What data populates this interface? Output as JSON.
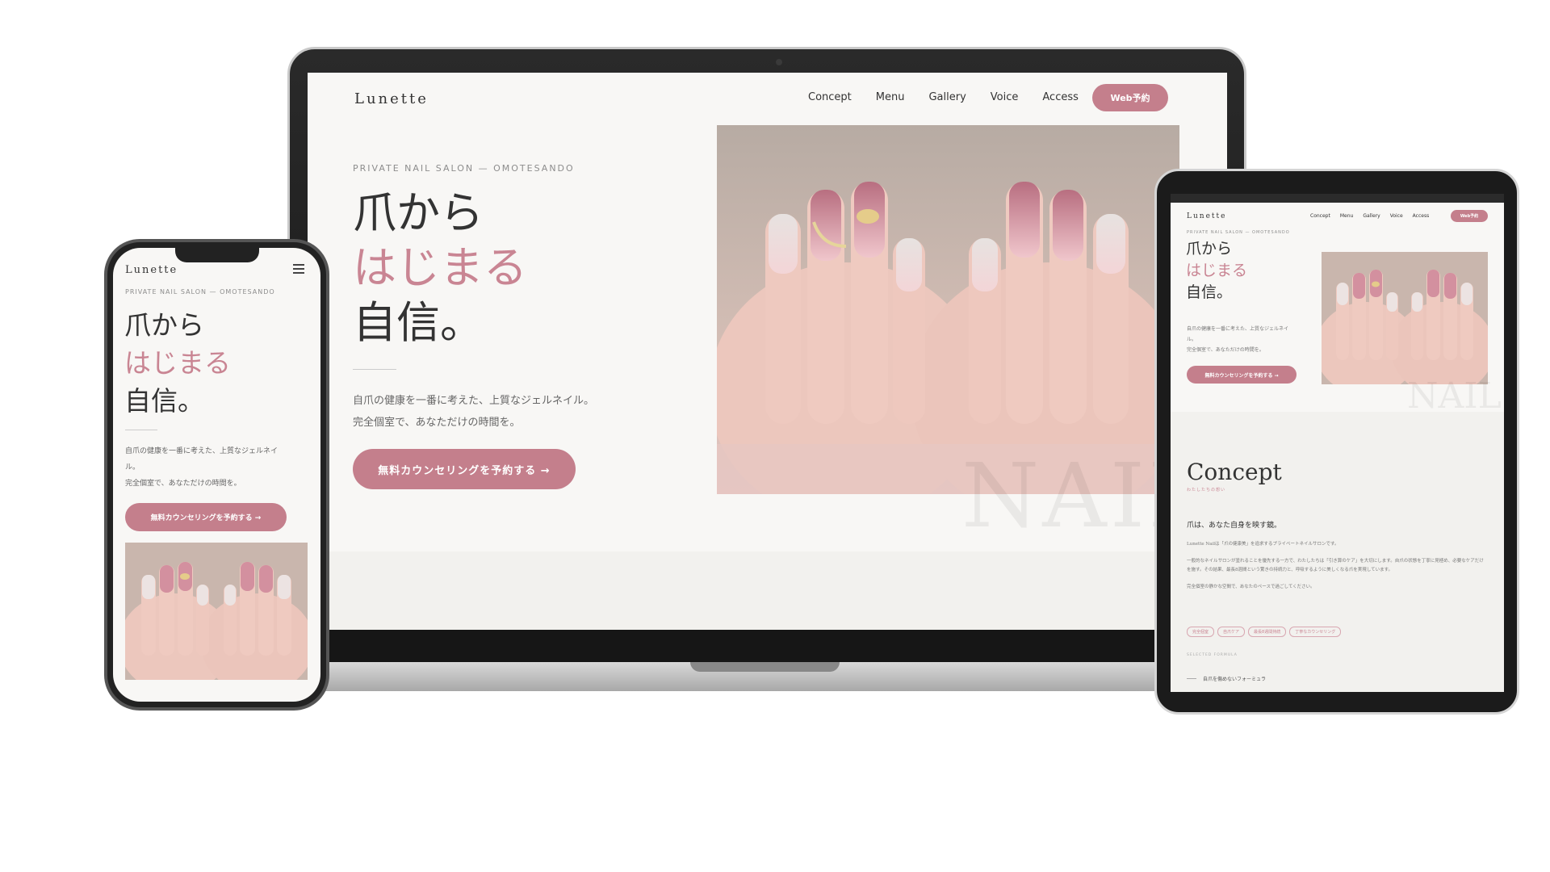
{
  "site": {
    "logo": "Lunette",
    "nav": [
      "Concept",
      "Menu",
      "Gallery",
      "Voice",
      "Access"
    ],
    "nav_cta": "Web予約",
    "eyebrow": "PRIVATE NAIL SALON — OMOTESANDO",
    "headline_line1": "爪から",
    "headline_line2": "はじまる",
    "headline_line3": "自信。",
    "desc_line1": "自爪の健康を一番に考えた、上質なジェルネイル。",
    "desc_line2": "完全個室で、あなただけの時間を。",
    "cta": "無料カウンセリングを予約する →",
    "watermark": "NAIL"
  },
  "phone": {
    "desc_line1": "自爪の健康を一番に考えた、上質なジェルネイ",
    "desc_line1b": "ル。",
    "desc_line2": "完全個室で、あなただけの時間を。"
  },
  "tablet": {
    "desc_line1": "自爪の健康を一番に考えた、上質なジェルネイ",
    "desc_line1b": "ル。",
    "desc_line2": "完全個室で、あなただけの時間を。",
    "concept_title": "Concept",
    "concept_sub": "わたしたちの想い",
    "lead": "爪は、あなた自身を映す鏡。",
    "body": [
      "Lunette Nailは「爪の健康美」を追求するプライベートネイルサロンです。",
      "一般的なネイルサロンが塗れることを優先する一方で、わたしたちは「引き算のケア」を大切にします。自爪の状態を丁寧に見極め、必要なケアだけを施す。その結果、最長8週間という驚きの持続力と、呼吸するように美しくなる爪を実現しています。",
      "完全個室の静かな空間で、あなたのペースで過ごしてください。"
    ],
    "tags": [
      "完全個室",
      "自爪ケア",
      "最長8週間持続",
      "丁寧なカウンセリング"
    ],
    "section_label": "SELECTED FORMULA",
    "formula": "自爪を傷めないフォーミュラ"
  },
  "colors": {
    "accent": "#c47f8c",
    "accent_text": "#c98593",
    "background": "#f8f7f5"
  }
}
